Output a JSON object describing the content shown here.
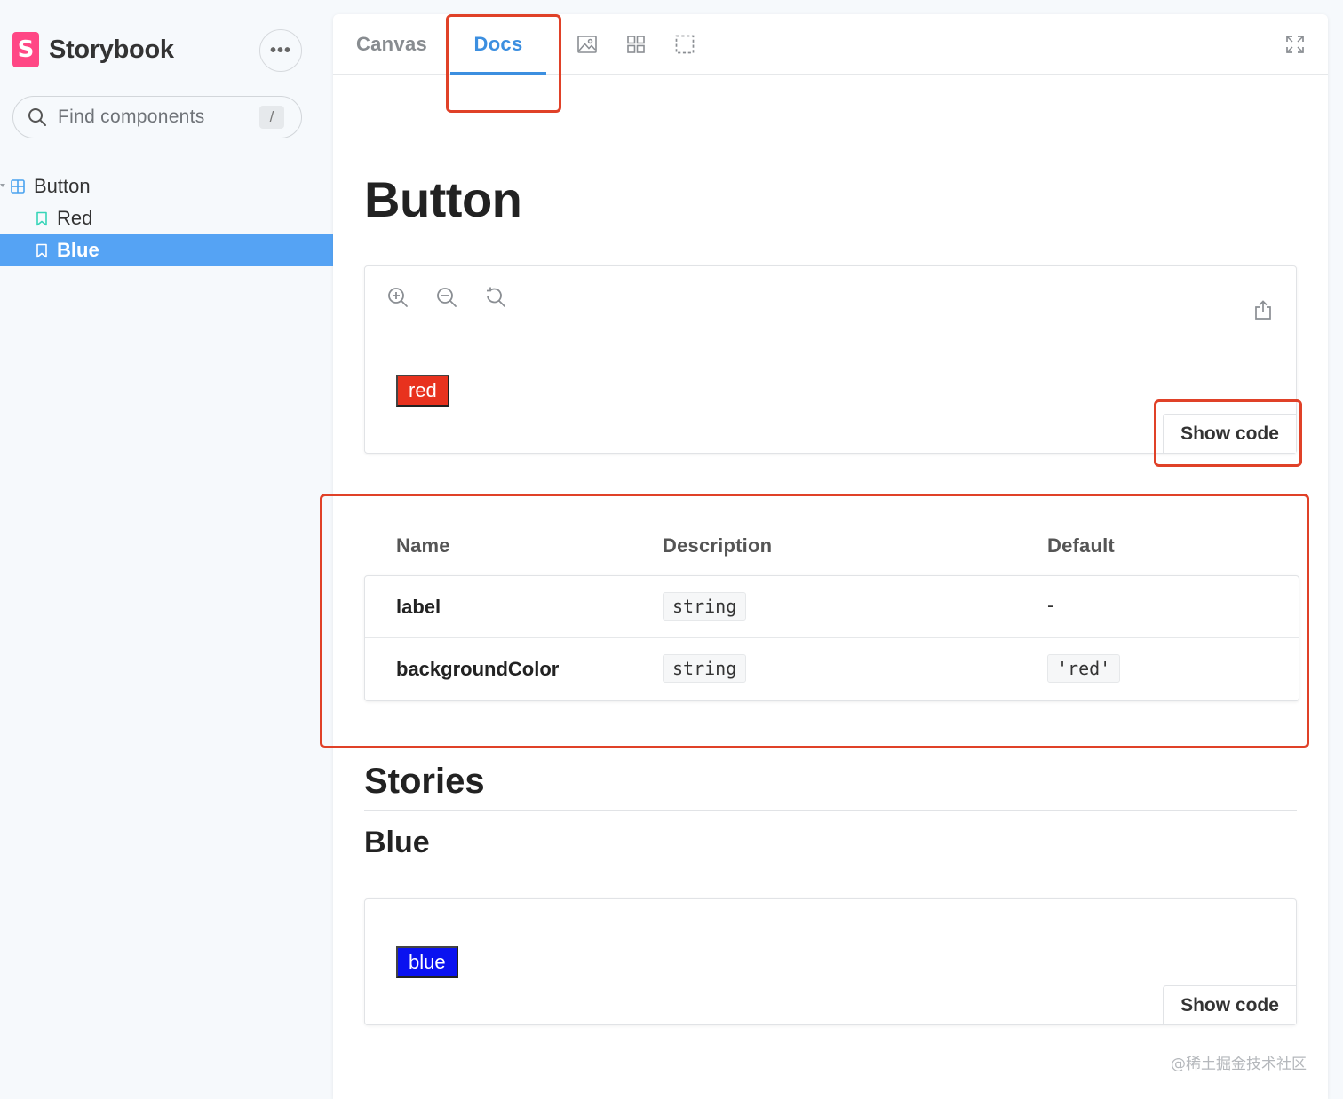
{
  "sidebar": {
    "brand_logo": "S",
    "brand_name": "Storybook",
    "more_label": "•••",
    "search": {
      "placeholder": "Find components",
      "shortcut": "/"
    },
    "tree": {
      "group": "Button",
      "items": [
        {
          "label": "Red",
          "selected": false
        },
        {
          "label": "Blue",
          "selected": true
        }
      ]
    },
    "selected_color": "#55a3f4"
  },
  "toolbar": {
    "tabs": [
      {
        "label": "Canvas",
        "active": false
      },
      {
        "label": "Docs",
        "active": true
      }
    ],
    "tools": [
      "image-icon",
      "grid-icon",
      "outline-icon"
    ],
    "fullscreen": "fullscreen-icon",
    "active_color": "#3c8fe0"
  },
  "doc": {
    "title": "Button",
    "primary_preview": {
      "tools": [
        "zoom-in-icon",
        "zoom-out-icon",
        "zoom-reset-icon",
        "share-icon"
      ],
      "button_label": "red",
      "button_color": "#e8321e",
      "show_code": "Show code"
    },
    "args_table": {
      "headers": [
        "Name",
        "Description",
        "Default"
      ],
      "rows": [
        {
          "name": "label",
          "type": "string",
          "default": "-"
        },
        {
          "name": "backgroundColor",
          "type": "string",
          "default": "'red'"
        }
      ]
    },
    "stories_heading": "Stories",
    "story": {
      "title": "Blue",
      "button_label": "blue",
      "button_color": "#0a12f0",
      "show_code": "Show code"
    }
  },
  "annotations": {
    "highlight_color": "#e04128"
  },
  "watermark": "@稀土掘金技术社区"
}
